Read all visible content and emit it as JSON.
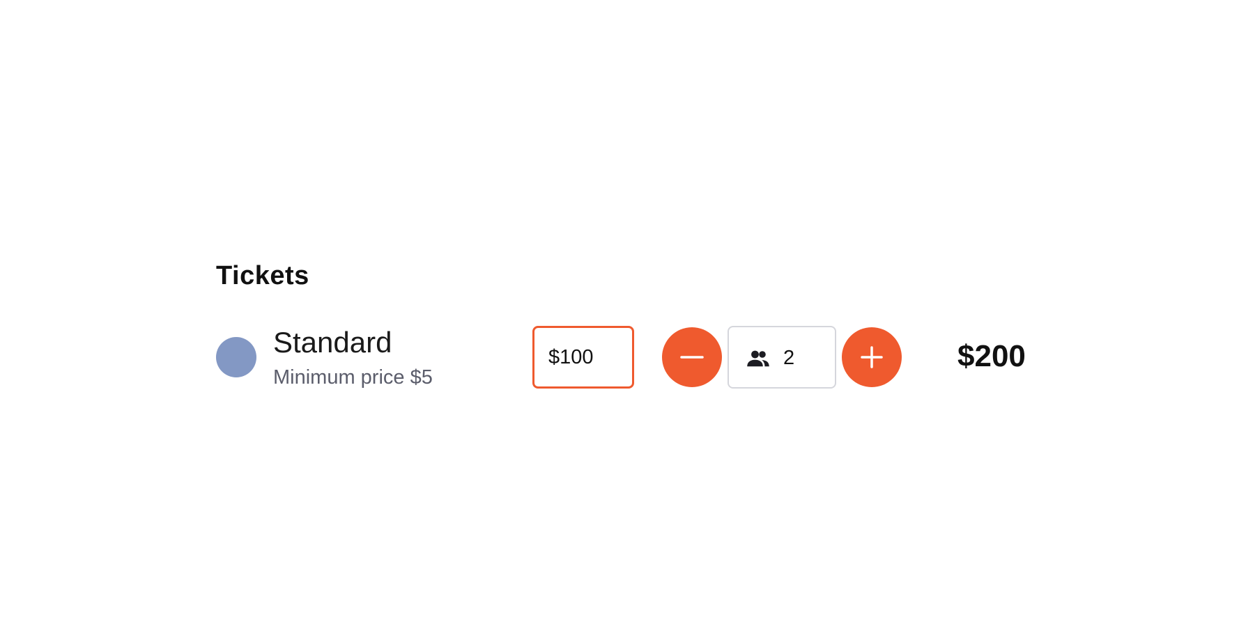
{
  "section": {
    "title": "Tickets"
  },
  "ticket": {
    "name": "Standard",
    "subtitle": "Minimum price $5",
    "dot_color": "#8398c4",
    "price_value": "$100",
    "quantity": "2",
    "total": "$200"
  },
  "controls": {
    "accent_color": "#ef5a2e",
    "decrement_icon": "minus-icon",
    "increment_icon": "plus-icon",
    "quantity_icon": "people-icon"
  }
}
